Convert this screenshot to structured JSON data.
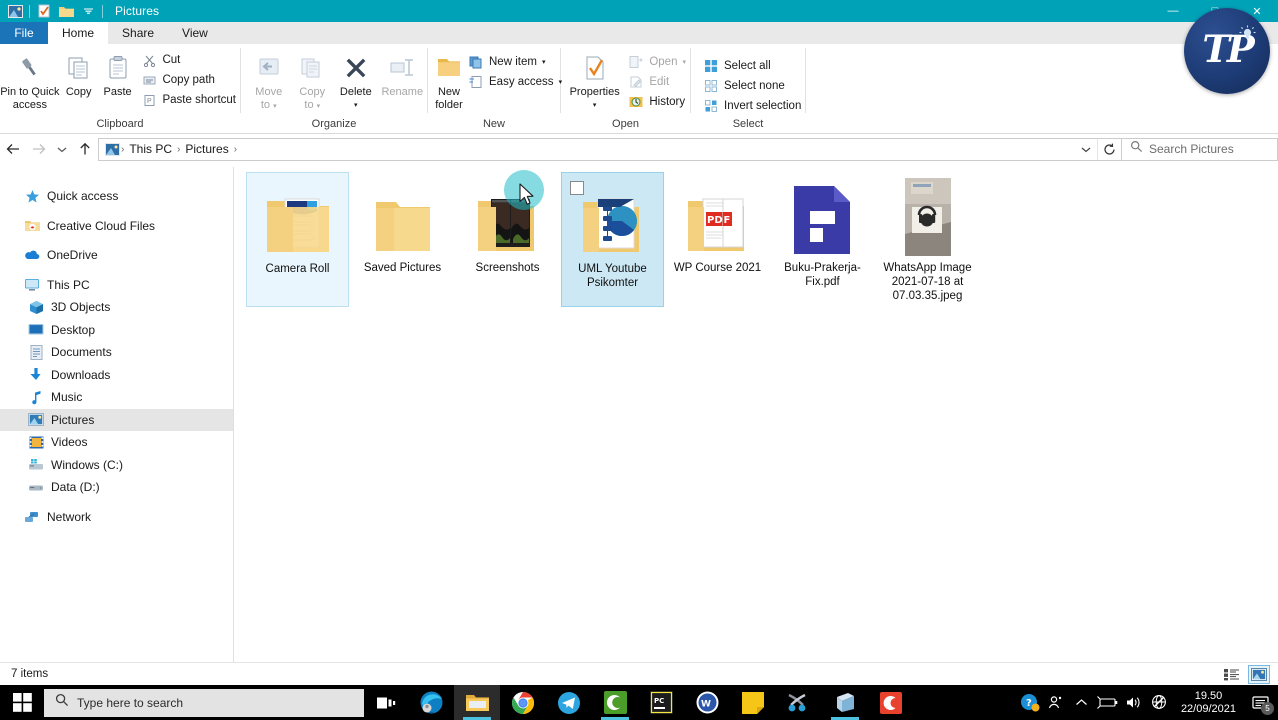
{
  "window": {
    "title": "Pictures",
    "quick_access_icons": [
      "pictures-icon",
      "properties-icon",
      "new-folder-icon",
      "qat-dropdown-icon"
    ],
    "minimize_label": "—",
    "maximize_label": "□",
    "close_label": "✕"
  },
  "tabs": {
    "file": "File",
    "items": [
      {
        "label": "Home",
        "active": true
      },
      {
        "label": "Share",
        "active": false
      },
      {
        "label": "View",
        "active": false
      }
    ]
  },
  "ribbon": {
    "groups": [
      {
        "name": "Clipboard",
        "label": "Clipboard",
        "big_buttons": [
          {
            "label_line1": "Pin to Quick",
            "label_line2": "access",
            "icon": "pin-icon",
            "disabled": false
          },
          {
            "label_line1": "Copy",
            "label_line2": "",
            "icon": "copy-icon",
            "disabled": false
          },
          {
            "label_line1": "Paste",
            "label_line2": "",
            "icon": "paste-icon",
            "disabled": false
          }
        ],
        "small_buttons": [
          {
            "label": "Cut",
            "icon": "scissors-icon",
            "disabled": false
          },
          {
            "label": "Copy path",
            "icon": "copy-path-icon",
            "disabled": false
          },
          {
            "label": "Paste shortcut",
            "icon": "paste-shortcut-icon",
            "disabled": false
          }
        ]
      },
      {
        "name": "Organize",
        "label": "Organize",
        "big_buttons": [
          {
            "label_line1": "Move",
            "label_line2": "to",
            "icon": "move-to-icon",
            "disabled": true,
            "dropdown": true
          },
          {
            "label_line1": "Copy",
            "label_line2": "to",
            "icon": "copy-to-icon",
            "disabled": true,
            "dropdown": true
          },
          {
            "label_line1": "Delete",
            "label_line2": "",
            "icon": "delete-x-icon",
            "disabled": false,
            "dropdown": true
          },
          {
            "label_line1": "Rename",
            "label_line2": "",
            "icon": "rename-icon",
            "disabled": true
          }
        ],
        "small_buttons": []
      },
      {
        "name": "New",
        "label": "New",
        "big_buttons": [
          {
            "label_line1": "New",
            "label_line2": "folder",
            "icon": "new-folder-icon",
            "disabled": false
          }
        ],
        "small_buttons": [
          {
            "label": "New item",
            "icon": "new-item-icon",
            "disabled": false,
            "dropdown": true
          },
          {
            "label": "Easy access",
            "icon": "easy-access-icon",
            "disabled": false,
            "dropdown": true
          }
        ]
      },
      {
        "name": "Open",
        "label": "Open",
        "big_buttons": [
          {
            "label_line1": "Properties",
            "label_line2": "",
            "icon": "properties-icon",
            "disabled": false,
            "dropdown": true
          }
        ],
        "small_buttons": [
          {
            "label": "Open",
            "icon": "open-icon",
            "disabled": true,
            "dropdown": true
          },
          {
            "label": "Edit",
            "icon": "edit-icon",
            "disabled": true
          },
          {
            "label": "History",
            "icon": "history-icon",
            "disabled": false
          }
        ]
      },
      {
        "name": "Select",
        "label": "Select",
        "big_buttons": [],
        "small_buttons": [
          {
            "label": "Select all",
            "icon": "select-all-icon",
            "disabled": false
          },
          {
            "label": "Select none",
            "icon": "select-none-icon",
            "disabled": false
          },
          {
            "label": "Invert selection",
            "icon": "invert-selection-icon",
            "disabled": false
          }
        ]
      }
    ]
  },
  "addressbar": {
    "back_icon": "back-arrow-icon",
    "forward_icon": "forward-arrow-icon",
    "recent_icon": "recent-locations-icon",
    "up_icon": "up-arrow-icon",
    "location_icon": "pictures-icon",
    "breadcrumbs": [
      "This PC",
      "Pictures"
    ],
    "dropdown_icon": "chevron-down-icon",
    "refresh_icon": "refresh-icon",
    "search_placeholder": "Search Pictures",
    "search_value": "",
    "search_icon": "search-icon"
  },
  "sidebar": {
    "items": [
      {
        "label": "Quick access",
        "icon": "star-icon",
        "indent": false,
        "selected": false,
        "gap_after": true
      },
      {
        "label": "Creative Cloud Files",
        "icon": "creative-cloud-icon",
        "indent": false,
        "selected": false,
        "gap_after": true
      },
      {
        "label": "OneDrive",
        "icon": "onedrive-cloud-icon",
        "indent": false,
        "selected": false,
        "gap_after": true
      },
      {
        "label": "This PC",
        "icon": "this-pc-icon",
        "indent": false,
        "selected": false,
        "gap_after": false
      },
      {
        "label": "3D Objects",
        "icon": "3d-objects-icon",
        "indent": true,
        "selected": false,
        "gap_after": false
      },
      {
        "label": "Desktop",
        "icon": "desktop-icon",
        "indent": true,
        "selected": false,
        "gap_after": false
      },
      {
        "label": "Documents",
        "icon": "documents-icon",
        "indent": true,
        "selected": false,
        "gap_after": false
      },
      {
        "label": "Downloads",
        "icon": "downloads-icon",
        "indent": true,
        "selected": false,
        "gap_after": false
      },
      {
        "label": "Music",
        "icon": "music-icon",
        "indent": true,
        "selected": false,
        "gap_after": false
      },
      {
        "label": "Pictures",
        "icon": "pictures-icon",
        "indent": true,
        "selected": true,
        "gap_after": false
      },
      {
        "label": "Videos",
        "icon": "videos-icon",
        "indent": true,
        "selected": false,
        "gap_after": false
      },
      {
        "label": "Windows (C:)",
        "icon": "local-disk-icon",
        "indent": true,
        "selected": false,
        "gap_after": false
      },
      {
        "label": "Data (D:)",
        "icon": "hard-drive-icon",
        "indent": true,
        "selected": false,
        "gap_after": true
      },
      {
        "label": "Network",
        "icon": "network-icon",
        "indent": false,
        "selected": false,
        "gap_after": false
      }
    ]
  },
  "files": [
    {
      "name": "Camera Roll",
      "type": "folder",
      "thumb": "folder-camera-roll",
      "state": "focused",
      "checkbox": false
    },
    {
      "name": "Saved Pictures",
      "type": "folder",
      "thumb": "folder-plain",
      "state": "none",
      "checkbox": false
    },
    {
      "name": "Screenshots",
      "type": "folder",
      "thumb": "folder-screenshots",
      "state": "none",
      "checkbox": false
    },
    {
      "name": "UML Youtube Psikomter",
      "type": "folder",
      "thumb": "folder-uml",
      "state": "selected",
      "checkbox": true
    },
    {
      "name": "WP Course 2021",
      "type": "folder",
      "thumb": "folder-pdf",
      "state": "none",
      "checkbox": false
    },
    {
      "name": "Buku-Prakerja-Fix.pdf",
      "type": "file",
      "thumb": "pdf-document-icon",
      "state": "none",
      "checkbox": false
    },
    {
      "name": "WhatsApp Image 2021-07-18 at 07.03.35.jpeg",
      "type": "file",
      "thumb": "photo-thumbnail",
      "state": "none",
      "checkbox": false
    }
  ],
  "statusbar": {
    "item_count": "7 items",
    "view_buttons": [
      {
        "name": "details-view-button",
        "active": false
      },
      {
        "name": "large-icons-view-button",
        "active": true
      }
    ]
  },
  "taskbar": {
    "start_icon": "windows-start-icon",
    "search_placeholder": "Type here to search",
    "search_icon": "search-icon",
    "taskview_icon": "task-view-icon",
    "apps": [
      {
        "name": "microsoft-edge-icon",
        "active": false,
        "running": false
      },
      {
        "name": "file-explorer-icon",
        "active": true,
        "running": true
      },
      {
        "name": "google-chrome-icon",
        "active": false,
        "running": false
      },
      {
        "name": "telegram-icon",
        "active": false,
        "running": false
      },
      {
        "name": "camtasia-icon",
        "active": false,
        "running": true
      },
      {
        "name": "pycharm-icon",
        "active": false,
        "running": false
      },
      {
        "name": "wordpress-icon",
        "active": false,
        "running": false
      },
      {
        "name": "sticky-notes-icon",
        "active": false,
        "running": false
      },
      {
        "name": "snipping-tool-icon",
        "active": false,
        "running": false
      },
      {
        "name": "microsoft-store-icon",
        "active": false,
        "running": true
      },
      {
        "name": "camtasia-recorder-icon",
        "active": false,
        "running": false
      }
    ],
    "tray": {
      "help_icon": "help-circle-icon",
      "people_icon": "people-icon",
      "chevron_icon": "chevron-up-icon",
      "battery_icon": "battery-icon",
      "volume_icon": "volume-icon",
      "network_icon": "network-disconnected-icon",
      "time": "19.50",
      "date": "22/09/2021",
      "notification_icon": "notification-icon",
      "notification_count": "5"
    }
  },
  "overlay": {
    "logo_text": "TP",
    "logo_name": "tp-watermark-logo"
  },
  "colors": {
    "titlebar": "#00a2b8",
    "accent": "#0078d7",
    "selection": "#cce8f4",
    "taskbar": "#000000",
    "folder": "#f5cd7c"
  }
}
